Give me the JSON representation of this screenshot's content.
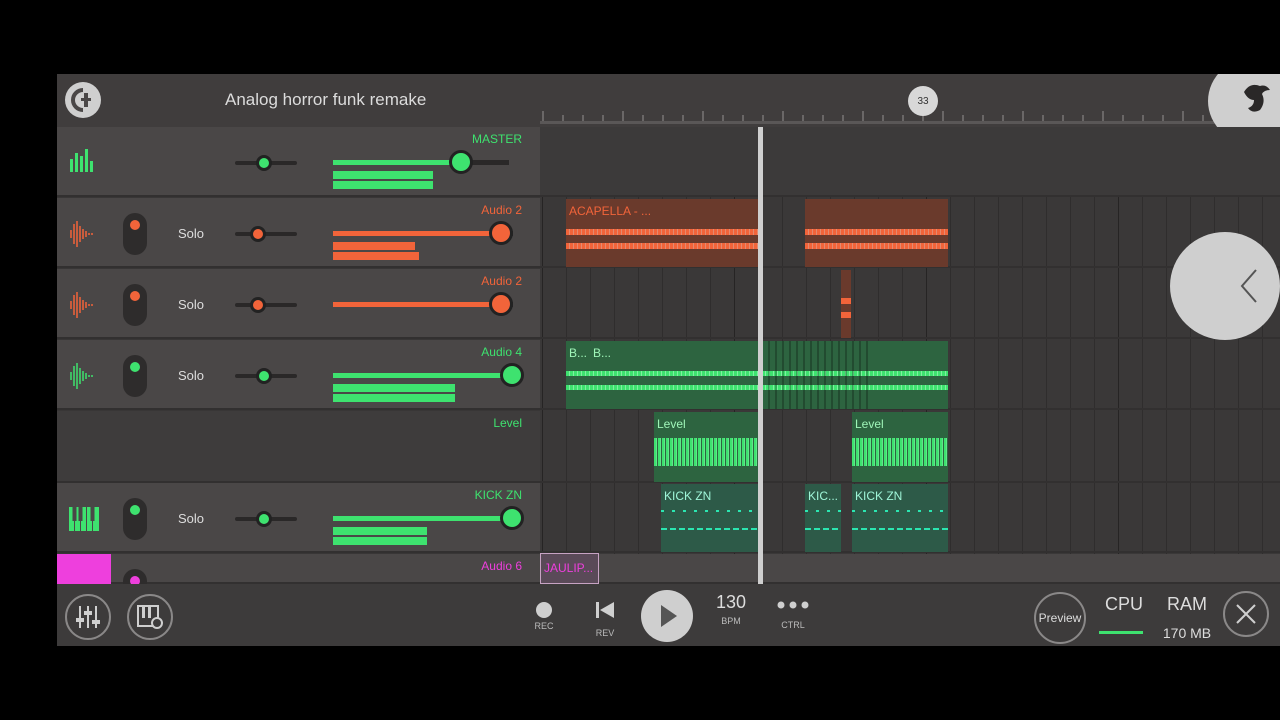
{
  "project": {
    "title": "Analog horror funk remake"
  },
  "timeline": {
    "position_marker": "33"
  },
  "colors": {
    "green": "#3ee26f",
    "orange": "#f2643a",
    "pink": "#ee3fdd",
    "teal": "#2be6b1"
  },
  "tracks": [
    {
      "name": "MASTER",
      "solo": "",
      "color": "#3ee26f",
      "icon": "mixer-bars-icon"
    },
    {
      "name": "Audio 2",
      "solo": "Solo",
      "color": "#f2643a",
      "icon": "audio-wave-icon"
    },
    {
      "name": "Audio 2",
      "solo": "Solo",
      "color": "#f2643a",
      "icon": "audio-wave-icon"
    },
    {
      "name": "Audio 4",
      "solo": "Solo",
      "color": "#3ee26f",
      "icon": "audio-wave-icon"
    },
    {
      "name": "Level",
      "solo": "",
      "color": "#3ee26f",
      "icon": ""
    },
    {
      "name": "KICK ZN",
      "solo": "Solo",
      "color": "#3ee26f",
      "icon": "piano-keys-icon"
    },
    {
      "name": "Audio 6",
      "solo": "",
      "color": "#ee3fdd",
      "icon": ""
    }
  ],
  "clips": {
    "acapella": "ACAPELLA - ...",
    "b1": "B...",
    "b2": "B...",
    "level1": "Level",
    "level2": "Level",
    "kick1": "KICK ZN",
    "kick2": "KIC...",
    "kick3": "KICK ZN",
    "jaulip": "JAULIP..."
  },
  "transport": {
    "rec": "REC",
    "rev": "REV",
    "bpm_value": "130",
    "bpm_label": "BPM",
    "ctrl": "CTRL",
    "preview": "Preview",
    "cpu": "CPU",
    "ram": "RAM",
    "ram_value": "170 MB"
  }
}
